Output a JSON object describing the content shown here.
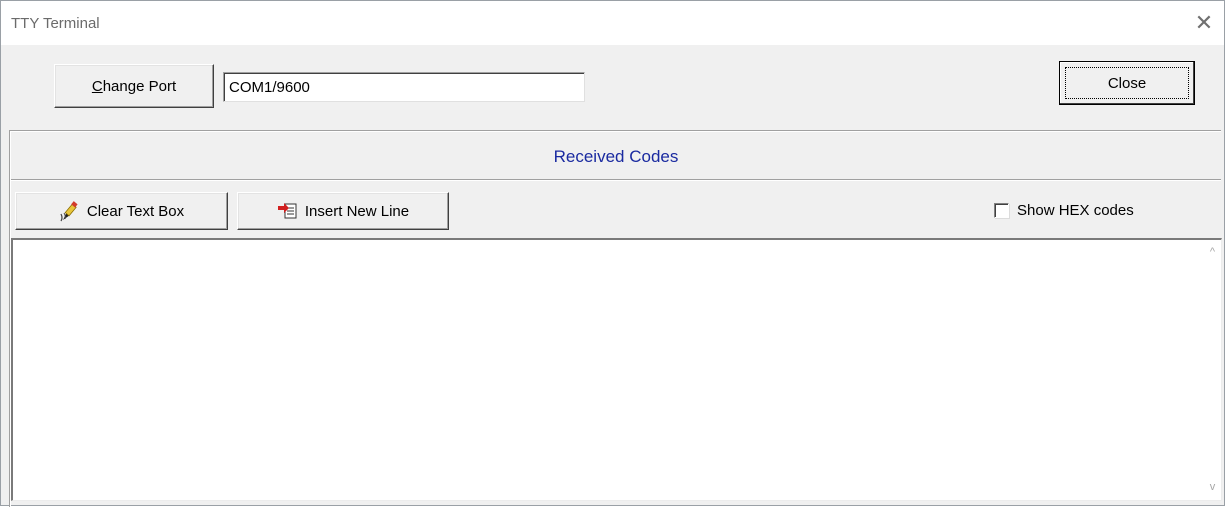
{
  "window": {
    "title": "TTY Terminal",
    "close_glyph": "✕"
  },
  "toolbar": {
    "change_port_label": "Change Port",
    "change_port_accel": "C",
    "change_port_rest": "hange Port",
    "port_value": "COM1/9600",
    "close_label": "Close"
  },
  "section": {
    "title": "Received Codes"
  },
  "actions": {
    "clear_label": "Clear Text Box",
    "clear_icon": "eraser-icon",
    "insert_label": "Insert New Line",
    "insert_icon": "insert-line-icon",
    "hex_label": "Show HEX codes",
    "hex_checked": false
  },
  "received": {
    "text": ""
  },
  "colors": {
    "section_title": "#1a2aa0",
    "face": "#f0f0f0"
  }
}
